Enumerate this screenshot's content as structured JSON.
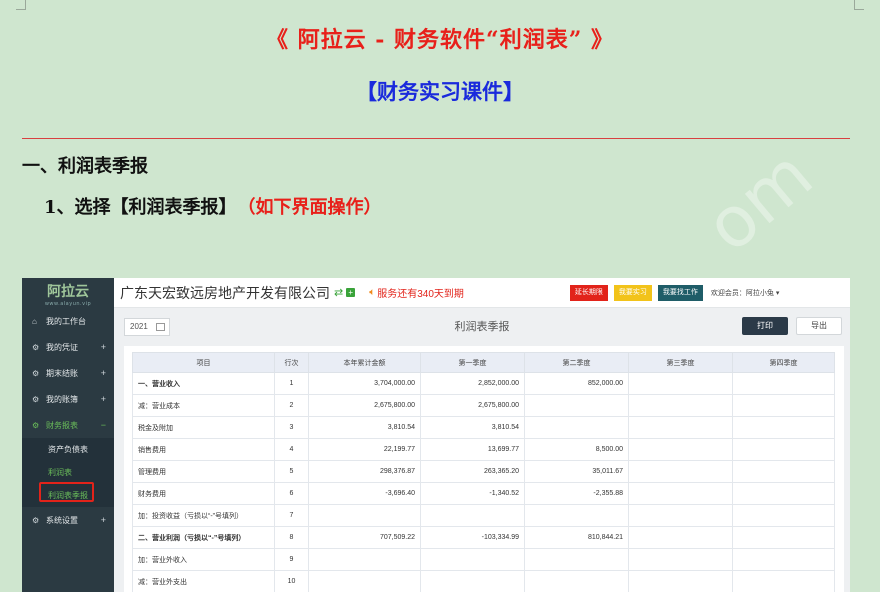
{
  "doc": {
    "title": "《 阿拉云 - 财务软件“利润表” 》",
    "subtitle": "【财务实习课件】",
    "heading1": "一、利润表季报",
    "heading2": "1、选择【利润表季报】",
    "heading2_note": "（如下界面操作）",
    "watermark": "om"
  },
  "app": {
    "logo": "阿拉云",
    "logo_url": "www.alayun.vip",
    "company": "广东天宏致远房地产开发有限公司",
    "service_notice": "服务还有340天到期",
    "btn_extend": "延长期限",
    "btn_practice": "我要实习",
    "btn_job": "我要找工作",
    "welcome": "欢迎会员：阿拉小兔 ▾",
    "colors": {
      "sidebar": "#2b3a42",
      "accent": "#6bbf5a",
      "danger": "#e2231a"
    }
  },
  "sidebar": {
    "items": [
      {
        "label": "我的工作台",
        "icon": "home-icon",
        "glyph": "⌂",
        "plus": ""
      },
      {
        "label": "我的凭证",
        "icon": "gears-icon",
        "glyph": "⚙",
        "plus": "+"
      },
      {
        "label": "期末结账",
        "icon": "gears-icon",
        "glyph": "⚙",
        "plus": "+"
      },
      {
        "label": "我的账簿",
        "icon": "gears-icon",
        "glyph": "⚙",
        "plus": "+"
      },
      {
        "label": "财务报表",
        "icon": "gears-icon",
        "glyph": "⚙",
        "plus": "−"
      }
    ],
    "sub_items": [
      {
        "label": "资产负债表"
      },
      {
        "label": "利润表"
      },
      {
        "label": "利润表季报"
      }
    ],
    "last_item": {
      "label": "系统设置",
      "icon": "gears-icon",
      "glyph": "⚙",
      "plus": "+"
    }
  },
  "toolbar": {
    "year": "2021",
    "report_title": "利润表季报",
    "print": "打印",
    "export": "导出"
  },
  "table": {
    "headers": [
      "项目",
      "行次",
      "本年累计金额",
      "第一季度",
      "第二季度",
      "第三季度",
      "第四季度"
    ],
    "rows": [
      {
        "name": "一、营业收入",
        "line": "1",
        "ytd": "3,704,000.00",
        "q1": "2,852,000.00",
        "q2": "852,000.00",
        "q3": "",
        "q4": "",
        "bold": true
      },
      {
        "name": "减：营业成本",
        "line": "2",
        "ytd": "2,675,800.00",
        "q1": "2,675,800.00",
        "q2": "",
        "q3": "",
        "q4": "",
        "bold": false
      },
      {
        "name": "税金及附加",
        "line": "3",
        "ytd": "3,810.54",
        "q1": "3,810.54",
        "q2": "",
        "q3": "",
        "q4": "",
        "bold": false
      },
      {
        "name": "销售费用",
        "line": "4",
        "ytd": "22,199.77",
        "q1": "13,699.77",
        "q2": "8,500.00",
        "q3": "",
        "q4": "",
        "bold": false
      },
      {
        "name": "管理费用",
        "line": "5",
        "ytd": "298,376.87",
        "q1": "263,365.20",
        "q2": "35,011.67",
        "q3": "",
        "q4": "",
        "bold": false
      },
      {
        "name": "财务费用",
        "line": "6",
        "ytd": "-3,696.40",
        "q1": "-1,340.52",
        "q2": "-2,355.88",
        "q3": "",
        "q4": "",
        "bold": false
      },
      {
        "name": "加：投资收益（亏损以“-”号填列）",
        "line": "7",
        "ytd": "",
        "q1": "",
        "q2": "",
        "q3": "",
        "q4": "",
        "bold": false
      },
      {
        "name": "二、营业利润（亏损以“-”号填列）",
        "line": "8",
        "ytd": "707,509.22",
        "q1": "-103,334.99",
        "q2": "810,844.21",
        "q3": "",
        "q4": "",
        "bold": true
      },
      {
        "name": "加：营业外收入",
        "line": "9",
        "ytd": "",
        "q1": "",
        "q2": "",
        "q3": "",
        "q4": "",
        "bold": false
      },
      {
        "name": "减：营业外支出",
        "line": "10",
        "ytd": "",
        "q1": "",
        "q2": "",
        "q3": "",
        "q4": "",
        "bold": false
      }
    ]
  }
}
